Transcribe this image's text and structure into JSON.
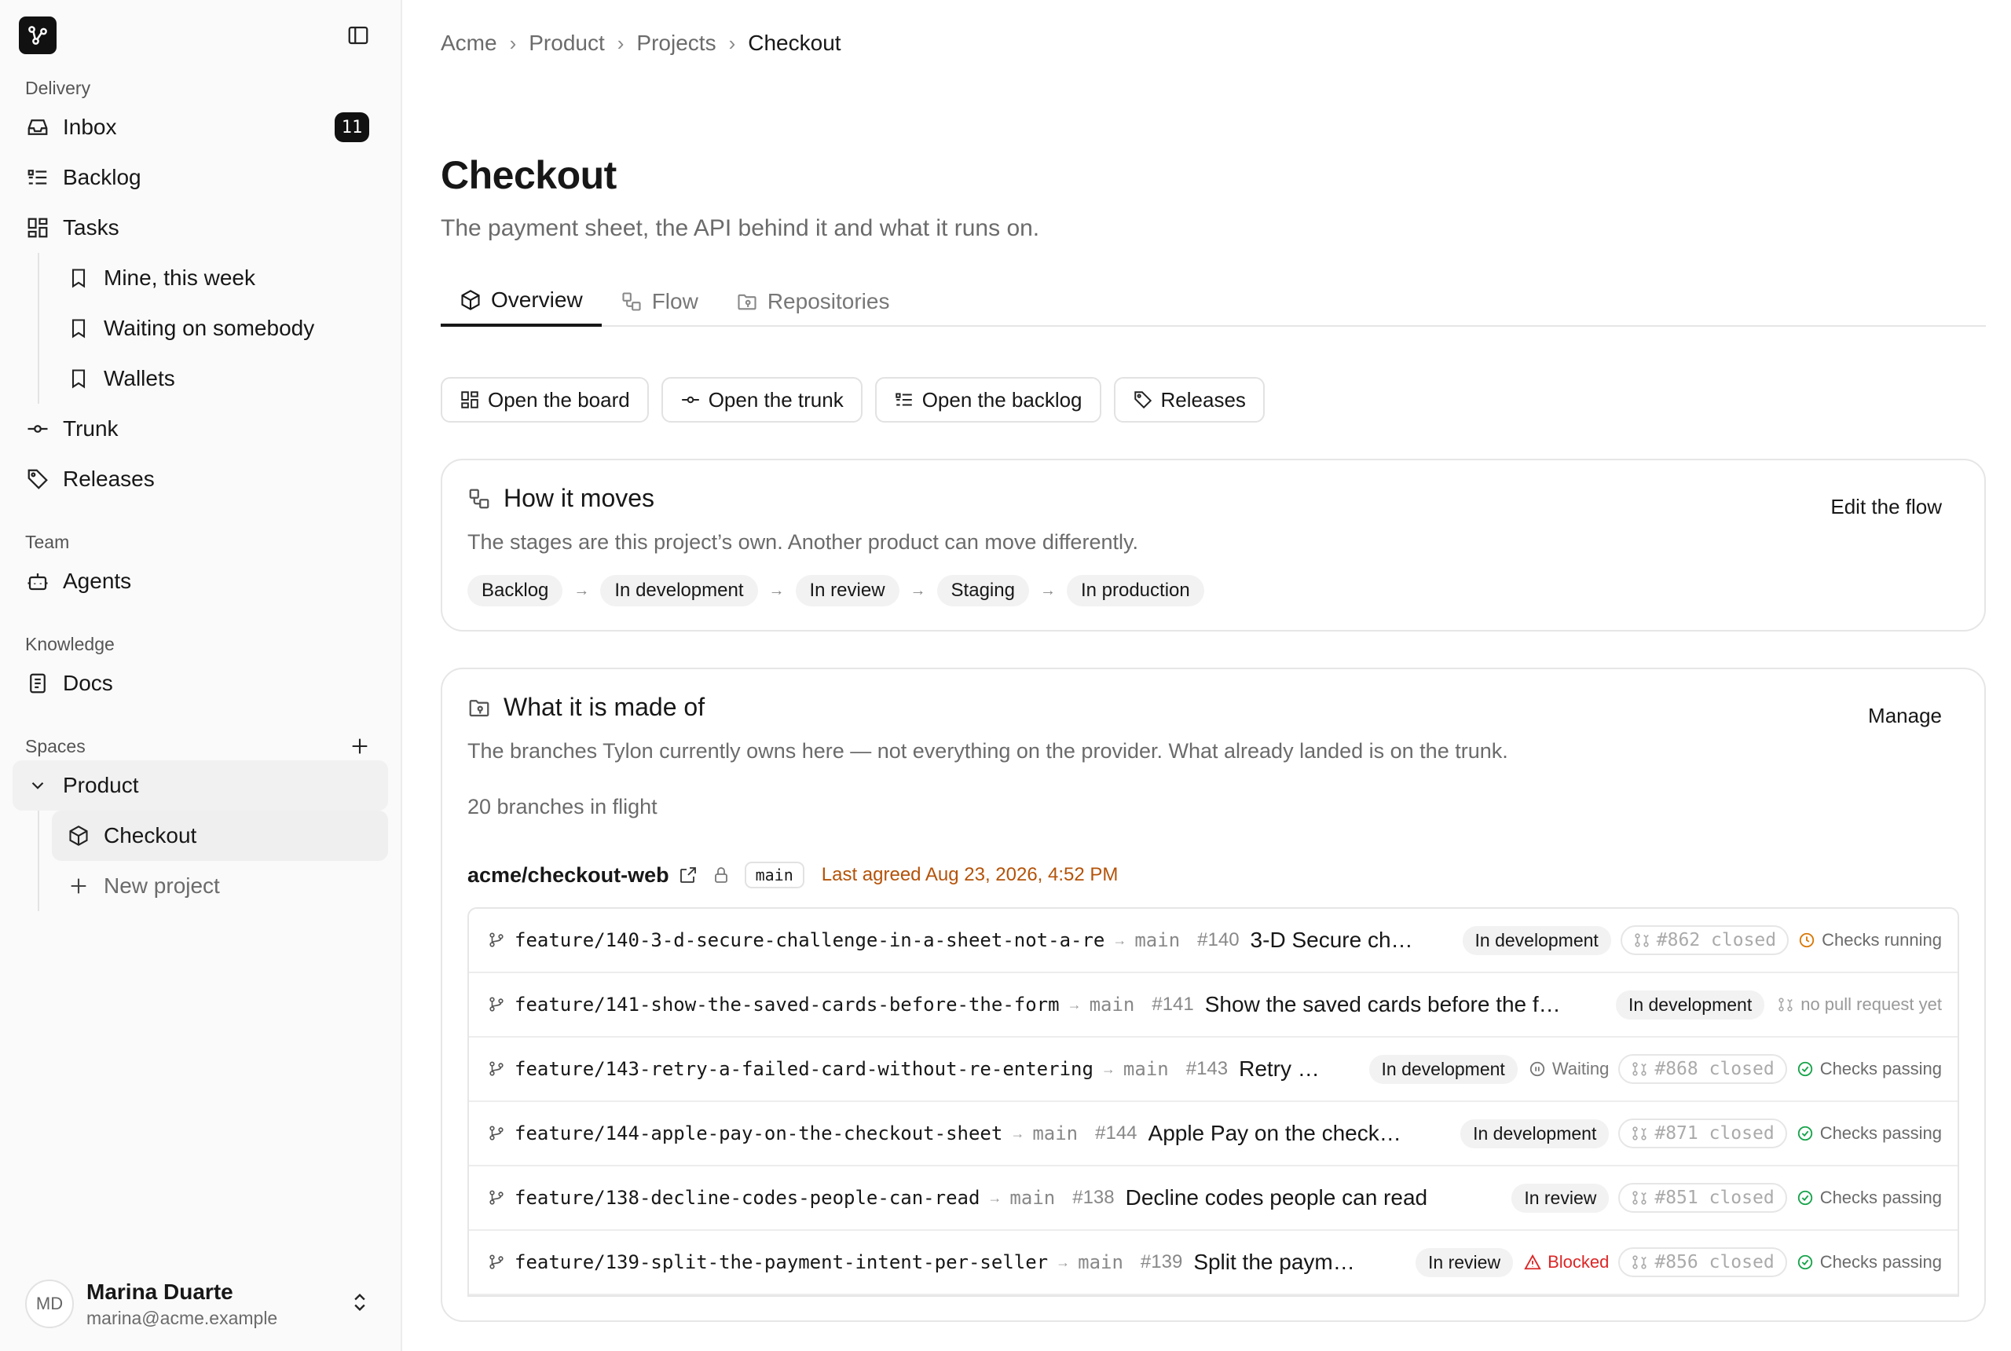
{
  "sidebar": {
    "sections": {
      "delivery": "Delivery",
      "team": "Team",
      "knowledge": "Knowledge",
      "spaces": "Spaces"
    },
    "inbox": {
      "label": "Inbox",
      "count": "11"
    },
    "backlog": "Backlog",
    "tasks": "Tasks",
    "task_views": [
      "Mine, this week",
      "Waiting on somebody",
      "Wallets"
    ],
    "trunk": "Trunk",
    "releases": "Releases",
    "agents": "Agents",
    "docs": "Docs",
    "space_product": "Product",
    "space_checkout": "Checkout",
    "new_project": "New project",
    "user": {
      "initials": "MD",
      "name": "Marina Duarte",
      "email": "marina@acme.example"
    }
  },
  "breadcrumb": [
    "Acme",
    "Product",
    "Projects",
    "Checkout"
  ],
  "page": {
    "title": "Checkout",
    "subtitle": "The payment sheet, the API behind it and what it runs on."
  },
  "tabs": [
    "Overview",
    "Flow",
    "Repositories"
  ],
  "actions": [
    "Open the board",
    "Open the trunk",
    "Open the backlog",
    "Releases"
  ],
  "flow_card": {
    "title": "How it moves",
    "action": "Edit the flow",
    "desc": "The stages are this project’s own. Another product can move differently.",
    "stages": [
      "Backlog",
      "In development",
      "In review",
      "Staging",
      "In production"
    ]
  },
  "made_card": {
    "title": "What it is made of",
    "action": "Manage",
    "desc": "The branches Tylon currently owns here — not everything on the provider. What already landed is on the trunk.",
    "inflight": "20 branches in flight",
    "repo": "acme/checkout-web",
    "default_branch": "main",
    "agreed": "Last agreed Aug 23, 2026, 4:52 PM"
  },
  "branches": [
    {
      "name": "feature/140-3-d-secure-challenge-in-a-sheet-not-a-re",
      "target": "main",
      "num": "#140",
      "title": "3-D Secure ch…",
      "stage": "In development",
      "status": "",
      "pr": "#862 closed",
      "checks": "Checks running",
      "checks_kind": "running"
    },
    {
      "name": "feature/141-show-the-saved-cards-before-the-form",
      "target": "main",
      "num": "#141",
      "title": "Show the saved cards before the f…",
      "stage": "In development",
      "status": "",
      "pr": "",
      "checks": "no pull request yet",
      "checks_kind": "none"
    },
    {
      "name": "feature/143-retry-a-failed-card-without-re-entering",
      "target": "main",
      "num": "#143",
      "title": "Retry …",
      "stage": "In development",
      "status": "Waiting",
      "status_kind": "waiting",
      "pr": "#868 closed",
      "checks": "Checks passing",
      "checks_kind": "passing"
    },
    {
      "name": "feature/144-apple-pay-on-the-checkout-sheet",
      "target": "main",
      "num": "#144",
      "title": "Apple Pay on the check…",
      "stage": "In development",
      "status": "",
      "pr": "#871 closed",
      "checks": "Checks passing",
      "checks_kind": "passing"
    },
    {
      "name": "feature/138-decline-codes-people-can-read",
      "target": "main",
      "num": "#138",
      "title": "Decline codes people can read",
      "stage": "In review",
      "status": "",
      "pr": "#851 closed",
      "checks": "Checks passing",
      "checks_kind": "passing"
    },
    {
      "name": "feature/139-split-the-payment-intent-per-seller",
      "target": "main",
      "num": "#139",
      "title": "Split the paym…",
      "stage": "In review",
      "status": "Blocked",
      "status_kind": "blocked",
      "pr": "#856 closed",
      "checks": "Checks passing",
      "checks_kind": "passing"
    }
  ],
  "colors": {
    "accent": "#171717",
    "blocked": "#dc2626",
    "running": "#d97706",
    "passing": "#16a34a",
    "agreed": "#b45309"
  }
}
